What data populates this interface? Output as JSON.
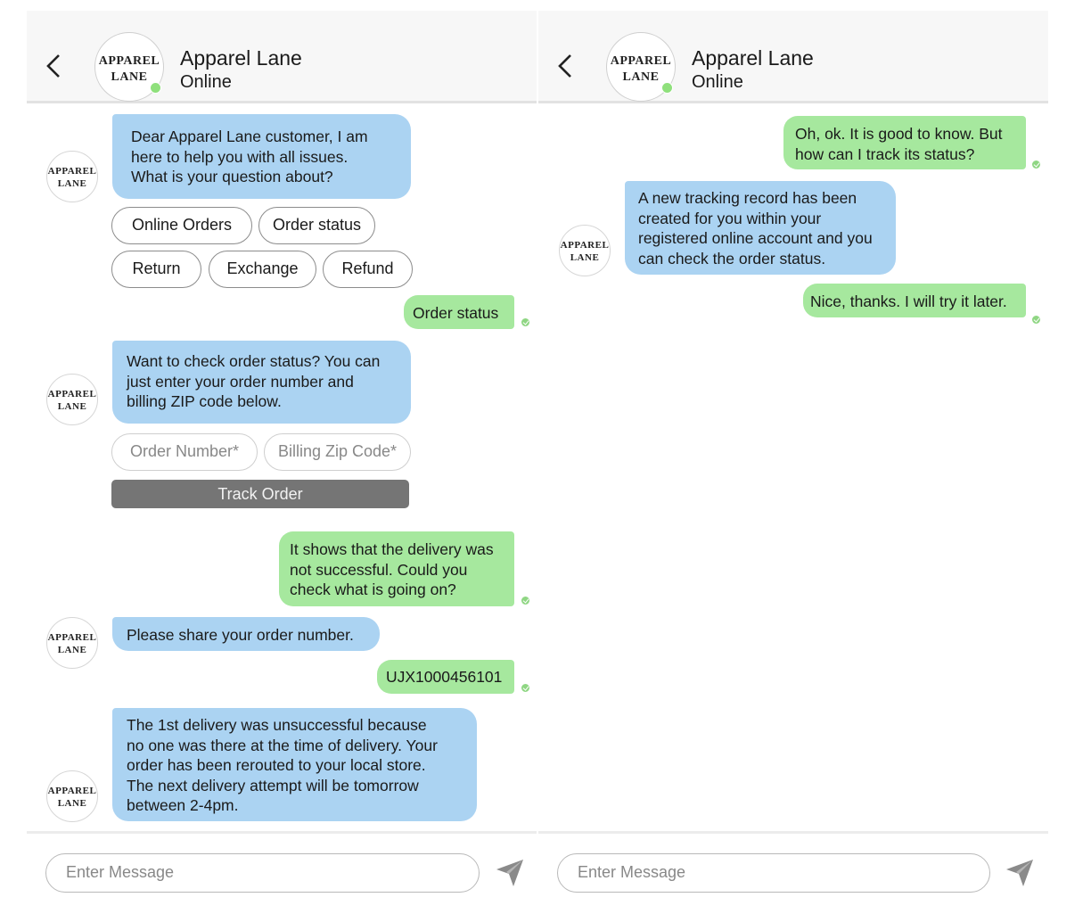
{
  "header": {
    "logo_line1": "APPAREL",
    "logo_line2": "LANE",
    "name": "Apparel Lane",
    "status": "Online"
  },
  "avatar": {
    "line1": "APPAREL",
    "line2": "LANE"
  },
  "colors": {
    "bot_bubble": "#abd3f2",
    "user_bubble": "#a6e89e",
    "online_dot": "#8fe07c",
    "track_button": "#757575"
  },
  "icons": {
    "back": "chevron-left-icon",
    "send": "paper-plane-icon",
    "status": "online-dot",
    "delivered": "check-icon"
  },
  "left": {
    "greeting": [
      "Dear Apparel Lane customer, I am",
      "here to help you with all issues.",
      "What is your question about?"
    ],
    "quick_replies": [
      "Online Orders",
      "Order status",
      "Return",
      "Exchange",
      "Refund"
    ],
    "user_choice": "Order status",
    "order_prompt": [
      "Want to check order status? You can",
      "just enter your order number and",
      "billing ZIP code below."
    ],
    "order_number_placeholder": "Order Number*",
    "zip_placeholder": "Billing Zip Code*",
    "track_button": "Track Order",
    "user_issue": [
      "It shows that the delivery was",
      "not successful. Could you",
      "check what is going on?"
    ],
    "ask_number": "Please share your order number.",
    "order_number": "UJX1000456101",
    "delivery_info": [
      "The 1st delivery was unsuccessful because",
      "no one was there at the time of delivery. Your",
      "order has been rerouted to your local store.",
      "The next delivery attempt will be tomorrow",
      "between 2-4pm."
    ]
  },
  "right": {
    "user_question": [
      "Oh, ok. It is good to know. But",
      "how can I track its status?"
    ],
    "tracking_info": [
      "A new tracking record has been",
      "created for you within your",
      "registered online account and you",
      "can check the order status."
    ],
    "user_thanks": "Nice, thanks. I will try it later."
  },
  "footer": {
    "placeholder": "Enter Message"
  }
}
